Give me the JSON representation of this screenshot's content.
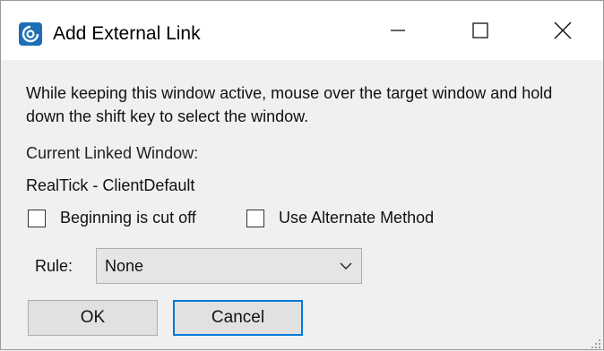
{
  "window": {
    "title": "Add External Link",
    "icon": "app-logo-icon",
    "accent_color": "#0078d7"
  },
  "titlebar_buttons": {
    "minimize_icon": "minimize-icon",
    "maximize_icon": "maximize-icon",
    "close_icon": "close-icon"
  },
  "dialog": {
    "instructions": "While keeping this window active, mouse over the target window and hold down the shift key to select the window.",
    "current_linked_label": "Current Linked Window:",
    "current_linked_value": "RealTick - ClientDefault",
    "checkbox_cut_off": {
      "label": "Beginning is cut off",
      "checked": false
    },
    "checkbox_alternate": {
      "label": "Use Alternate Method",
      "checked": false
    },
    "rule_label": "Rule:",
    "rule_selected": "None",
    "ok_label": "OK",
    "cancel_label": "Cancel"
  }
}
